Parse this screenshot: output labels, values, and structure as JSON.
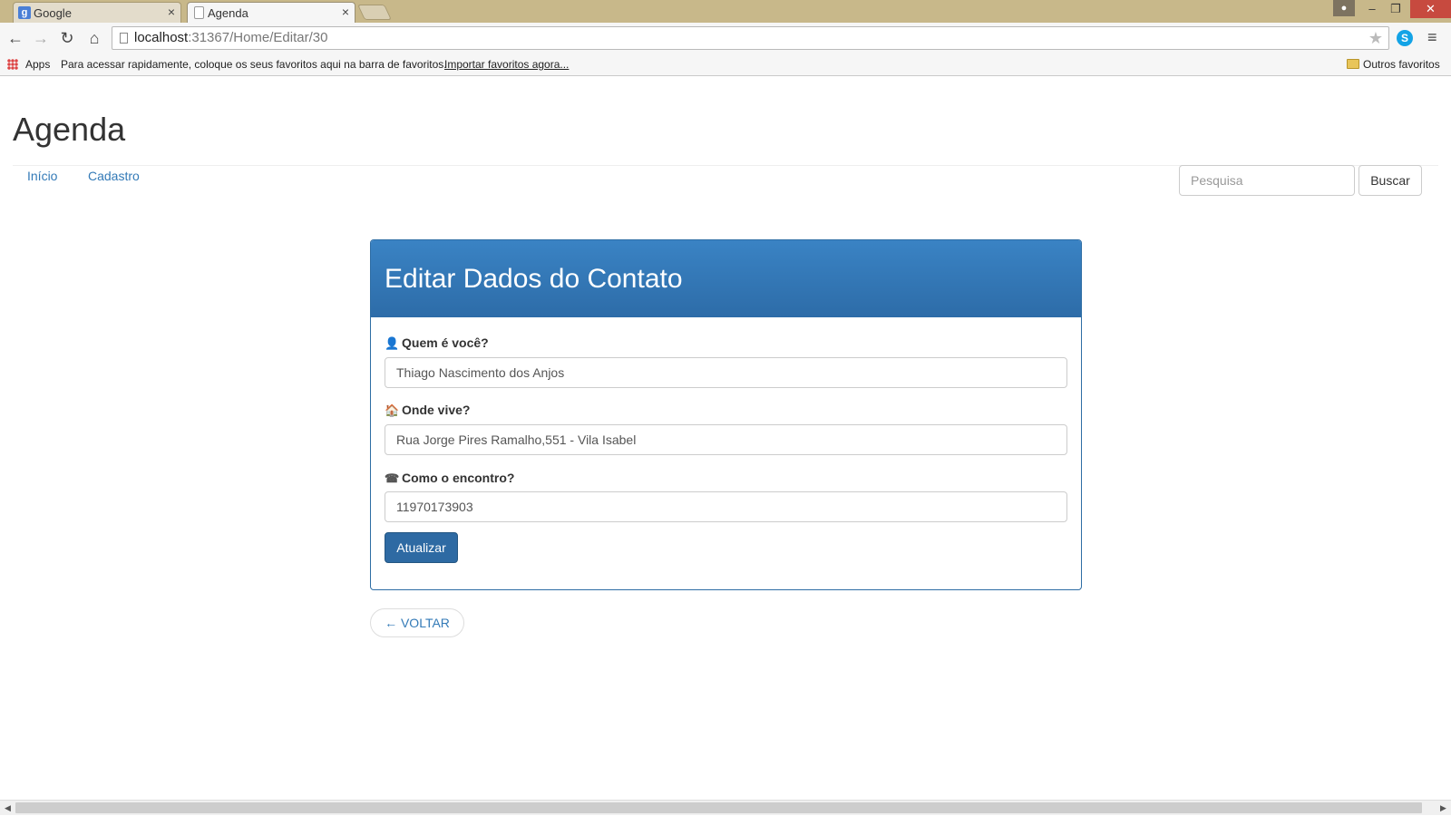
{
  "browser": {
    "tabs": [
      {
        "title": "Google",
        "favicon": "google-g-icon"
      },
      {
        "title": "Agenda",
        "favicon": "page-icon"
      }
    ],
    "url_host": "localhost",
    "url_path": ":31367/Home/Editar/30",
    "bookmarks": {
      "apps_label": "Apps",
      "message": "Para acessar rapidamente, coloque os seus favoritos aqui na barra de favoritos.",
      "import_link": "Importar favoritos agora...",
      "other_folder": "Outros favoritos"
    }
  },
  "site": {
    "brand": "Agenda",
    "nav": [
      "Início",
      "Cadastro"
    ],
    "search": {
      "placeholder": "Pesquisa",
      "button": "Buscar"
    }
  },
  "form": {
    "title": "Editar Dados do Contato",
    "fields": [
      {
        "label": "Quem é você?",
        "icon": "user-icon",
        "value": "Thiago Nascimento dos Anjos"
      },
      {
        "label": "Onde vive?",
        "icon": "home-icon",
        "value": "Rua Jorge Pires Ramalho,551 - Vila Isabel"
      },
      {
        "label": "Como o encontro?",
        "icon": "phone-icon",
        "value": "11970173903"
      }
    ],
    "submit": "Atualizar",
    "back": "← VOLTAR"
  },
  "colors": {
    "primary": "#337ab7",
    "panel_header": "#2e6da4",
    "tabstrip": "#c8b88a"
  }
}
